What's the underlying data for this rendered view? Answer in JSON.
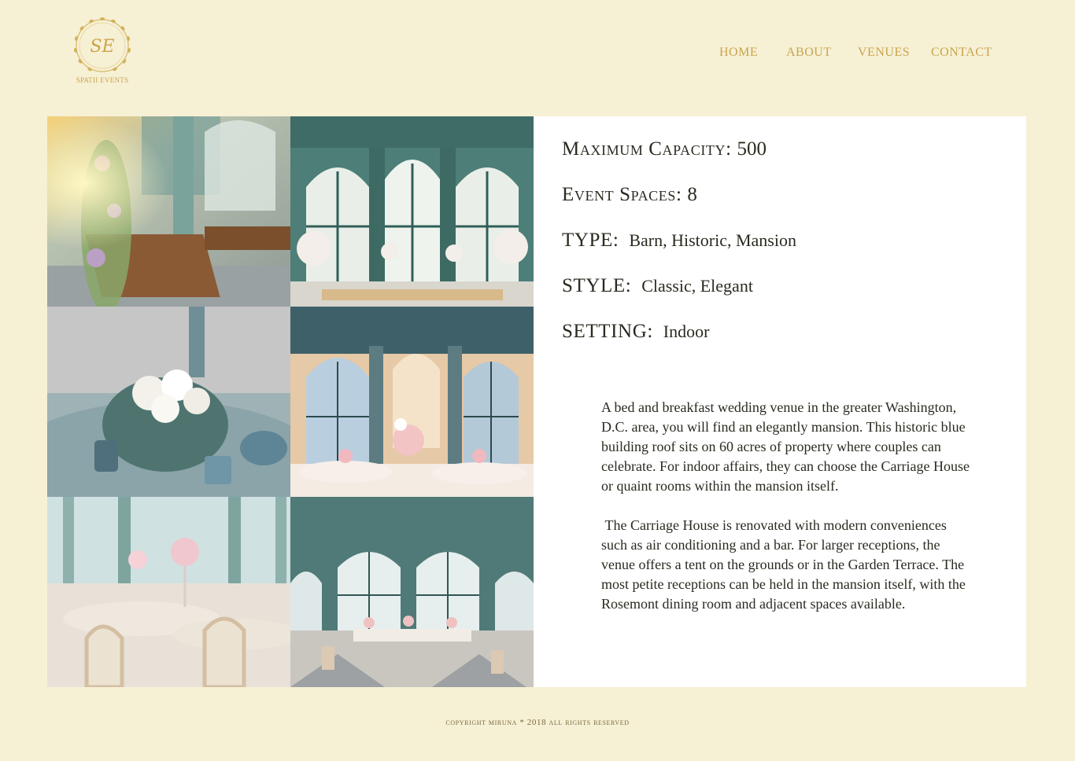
{
  "brand": {
    "name": "SPATII EVENTS",
    "monogram": "SE"
  },
  "nav": {
    "items": [
      {
        "label": "HOME"
      },
      {
        "label": "ABOUT"
      },
      {
        "label": "VENUES"
      },
      {
        "label": "CONTACT"
      }
    ]
  },
  "gallery": {
    "images": [
      {
        "alt": "Sunlit banquet hall with long table and floral arches"
      },
      {
        "alt": "Ceremony setup under green arched windows"
      },
      {
        "alt": "Table centerpiece with white flowers and blue glassware"
      },
      {
        "alt": "Round reception tables under arched hall"
      },
      {
        "alt": "Reception with round tables and tall floral arrangements"
      },
      {
        "alt": "Arched hall with head table and chairs"
      }
    ]
  },
  "details": {
    "capacity": {
      "label": "Maximum Capacity:",
      "value": "500"
    },
    "spaces": {
      "label": "Event Spaces:",
      "value": "8"
    },
    "type": {
      "label": "TYPE:",
      "value": "Barn, Historic, Mansion"
    },
    "style": {
      "label": "STYLE:",
      "value": "Classic, Elegant"
    },
    "setting": {
      "label": "SETTING:",
      "value": "Indoor"
    }
  },
  "description": {
    "paragraphs": [
      "A bed and breakfast wedding venue in the greater Washington, D.C. area, you will find an elegantly mansion. This historic blue building roof  sits on 60 acres of  property where couples can celebrate. For indoor affairs, they can choose the Carriage House or quaint rooms within the mansion itself.",
      " The Carriage House is renovated with modern conveniences such as air conditioning and a bar. For larger receptions, the venue offers a tent on the grounds or in the Garden Terrace. The most petite receptions can be held in the mansion itself, with the Rosemont dining room and adjacent spaces available."
    ]
  },
  "footer": {
    "text": "COPYRIGHT MIRUNA * 2018 ALL RIGHTS RESERVED"
  },
  "colors": {
    "background": "#f6f0d5",
    "gold": "#c9a54c",
    "panel": "#ffffff",
    "text": "#2b2a20"
  }
}
